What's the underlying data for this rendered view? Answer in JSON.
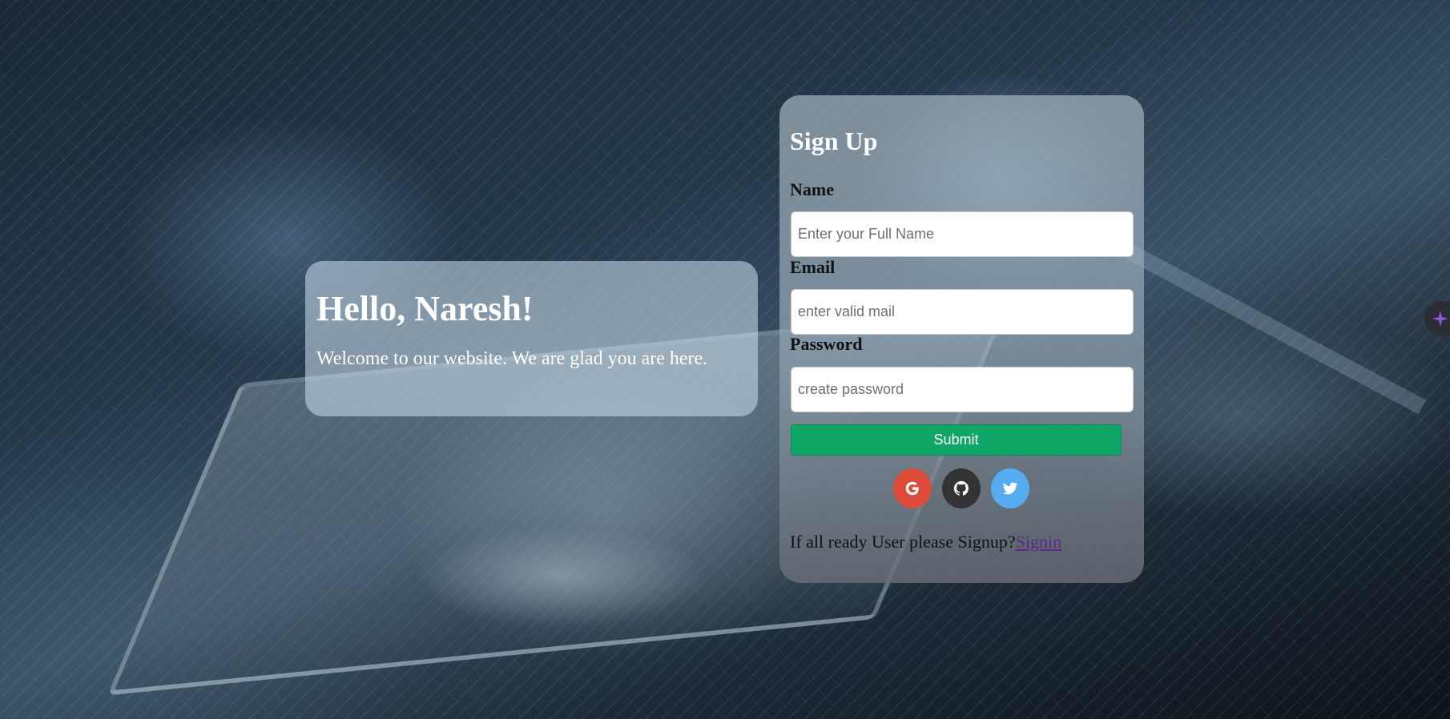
{
  "hello": {
    "title": "Hello, Naresh!",
    "message": "Welcome to our website. We are glad you are here."
  },
  "signup": {
    "title": "Sign Up",
    "name_label": "Name",
    "name_placeholder": "Enter your Full Name",
    "email_label": "Email",
    "email_placeholder": "enter valid mail",
    "password_label": "Password",
    "password_placeholder": "create password",
    "submit_label": "Submit",
    "social": [
      {
        "icon": "google-icon",
        "color": "#dd4b39"
      },
      {
        "icon": "github-icon",
        "color": "#333333"
      },
      {
        "icon": "twitter-icon",
        "color": "#55acee"
      }
    ],
    "signin_prompt": "If all ready User please Signup?",
    "signin_link": "Signin"
  },
  "colors": {
    "submit": "#10a668",
    "link": "#5a2a86",
    "widget_accent": "#8a5cd6"
  },
  "side_widget": {
    "icon": "sparkle-icon"
  }
}
